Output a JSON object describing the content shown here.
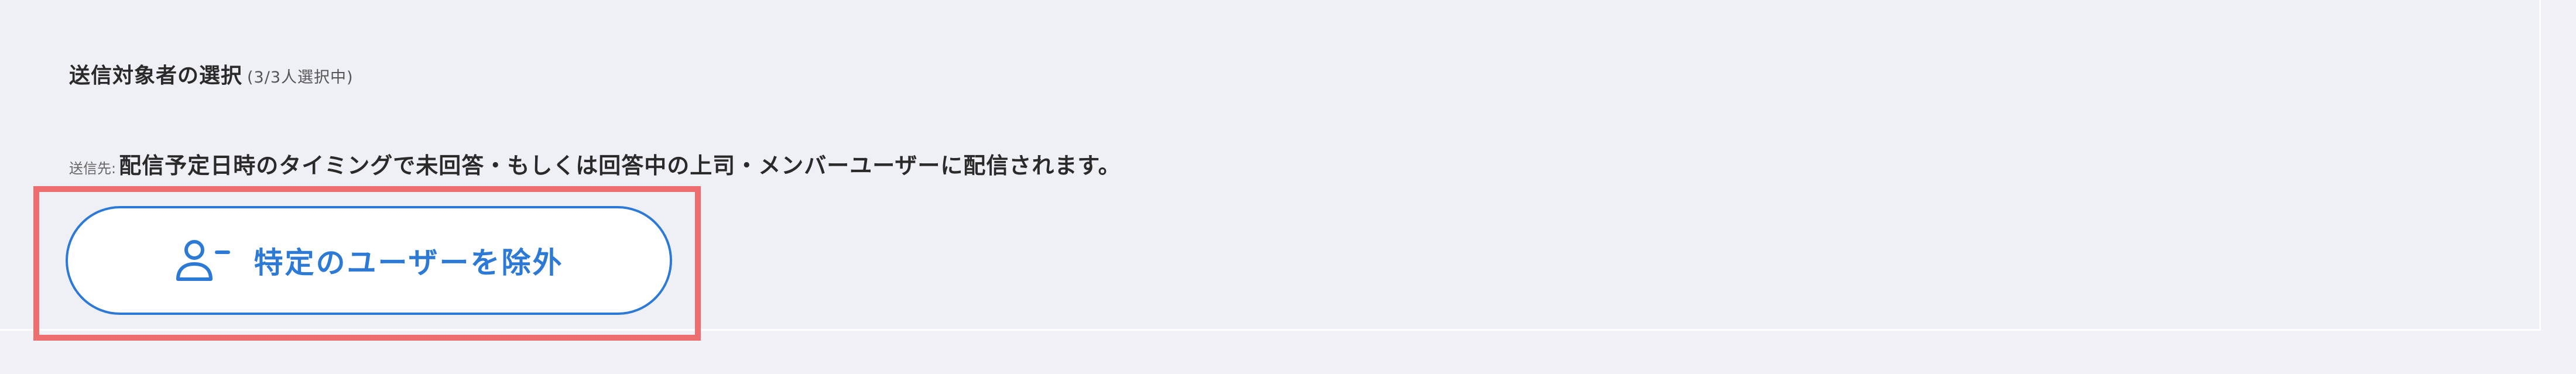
{
  "recipients": {
    "section_title": "送信対象者の選択",
    "selection_count": "(3/3人選択中)",
    "destination_label": "送信先:",
    "destination_text": "配信予定日時のタイミングで未回答・もしくは回答中の上司・メンバーユーザーに配信されます。"
  },
  "actions": {
    "exclude_users_label": "特定のユーザーを除外",
    "exclude_users_icon": "user-minus-icon"
  },
  "colors": {
    "accent": "#2d7ad6",
    "highlight": "#ee6d6f",
    "background": "#f1f1f7"
  }
}
